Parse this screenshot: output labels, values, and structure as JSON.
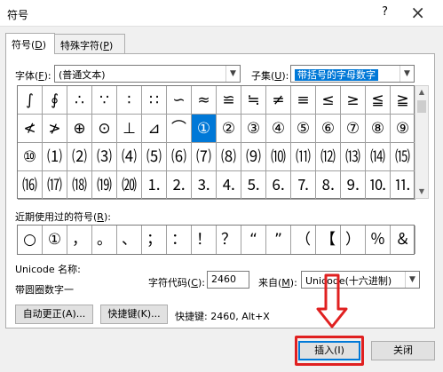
{
  "window": {
    "title": "符号",
    "help": "?",
    "close": "×"
  },
  "tabs": [
    {
      "label": "符号(",
      "key": "D",
      "suffix": ")"
    },
    {
      "label": "特殊字符(",
      "key": "P",
      "suffix": ")"
    }
  ],
  "font": {
    "label_pre": "字体(",
    "label_key": "F",
    "label_post": "):",
    "value": "(普通文本)"
  },
  "subset": {
    "label_pre": "子集(",
    "label_key": "U",
    "label_post": "):",
    "value": "带括号的字母数字"
  },
  "symbols": {
    "rows": [
      [
        "∫",
        "∮",
        "∴",
        "∵",
        "∶",
        "∷",
        "∽",
        "≈",
        "≌",
        "≒",
        "≠",
        "≡",
        "≤",
        "≥",
        "≦",
        "≧"
      ],
      [
        "≮",
        "≯",
        "⊕",
        "⊙",
        "⊥",
        "⊿",
        "⌒",
        "①",
        "②",
        "③",
        "④",
        "⑤",
        "⑥",
        "⑦",
        "⑧",
        "⑨"
      ],
      [
        "⑩",
        "⑴",
        "⑵",
        "⑶",
        "⑷",
        "⑸",
        "⑹",
        "⑺",
        "⑻",
        "⑼",
        "⑽",
        "⑾",
        "⑿",
        "⒀",
        "⒁",
        "⒂"
      ],
      [
        "⒃",
        "⒄",
        "⒅",
        "⒆",
        "⒇",
        "⒈",
        "⒉",
        "⒊",
        "⒋",
        "⒌",
        "⒍",
        "⒎",
        "⒏",
        "⒐",
        "⒑",
        "⒒"
      ]
    ],
    "selected": "①"
  },
  "recent": {
    "label_pre": "近期使用过的符号(",
    "label_key": "R",
    "label_post": "):",
    "items": [
      "○",
      "①",
      "，",
      "。",
      "、",
      "；",
      "：",
      "！",
      "？",
      "“",
      "”",
      "（",
      "【",
      "）",
      "％",
      "＆"
    ]
  },
  "unicode": {
    "name_label": "Unicode 名称:",
    "name_value": "带圆圈数字一",
    "code_label_pre": "字符代码(",
    "code_label_key": "C",
    "code_label_post": "):",
    "code_value": "2460",
    "from_label_pre": "来自(",
    "from_label_key": "M",
    "from_label_post": "):",
    "from_value": "Unicode(十六进制)"
  },
  "buttons": {
    "autocorrect": "自动更正(A)...",
    "shortcut_key": "快捷键(K)...",
    "shortcut_text": "快捷键: 2460, Alt+X",
    "insert": "插入(I)",
    "close": "关闭"
  }
}
